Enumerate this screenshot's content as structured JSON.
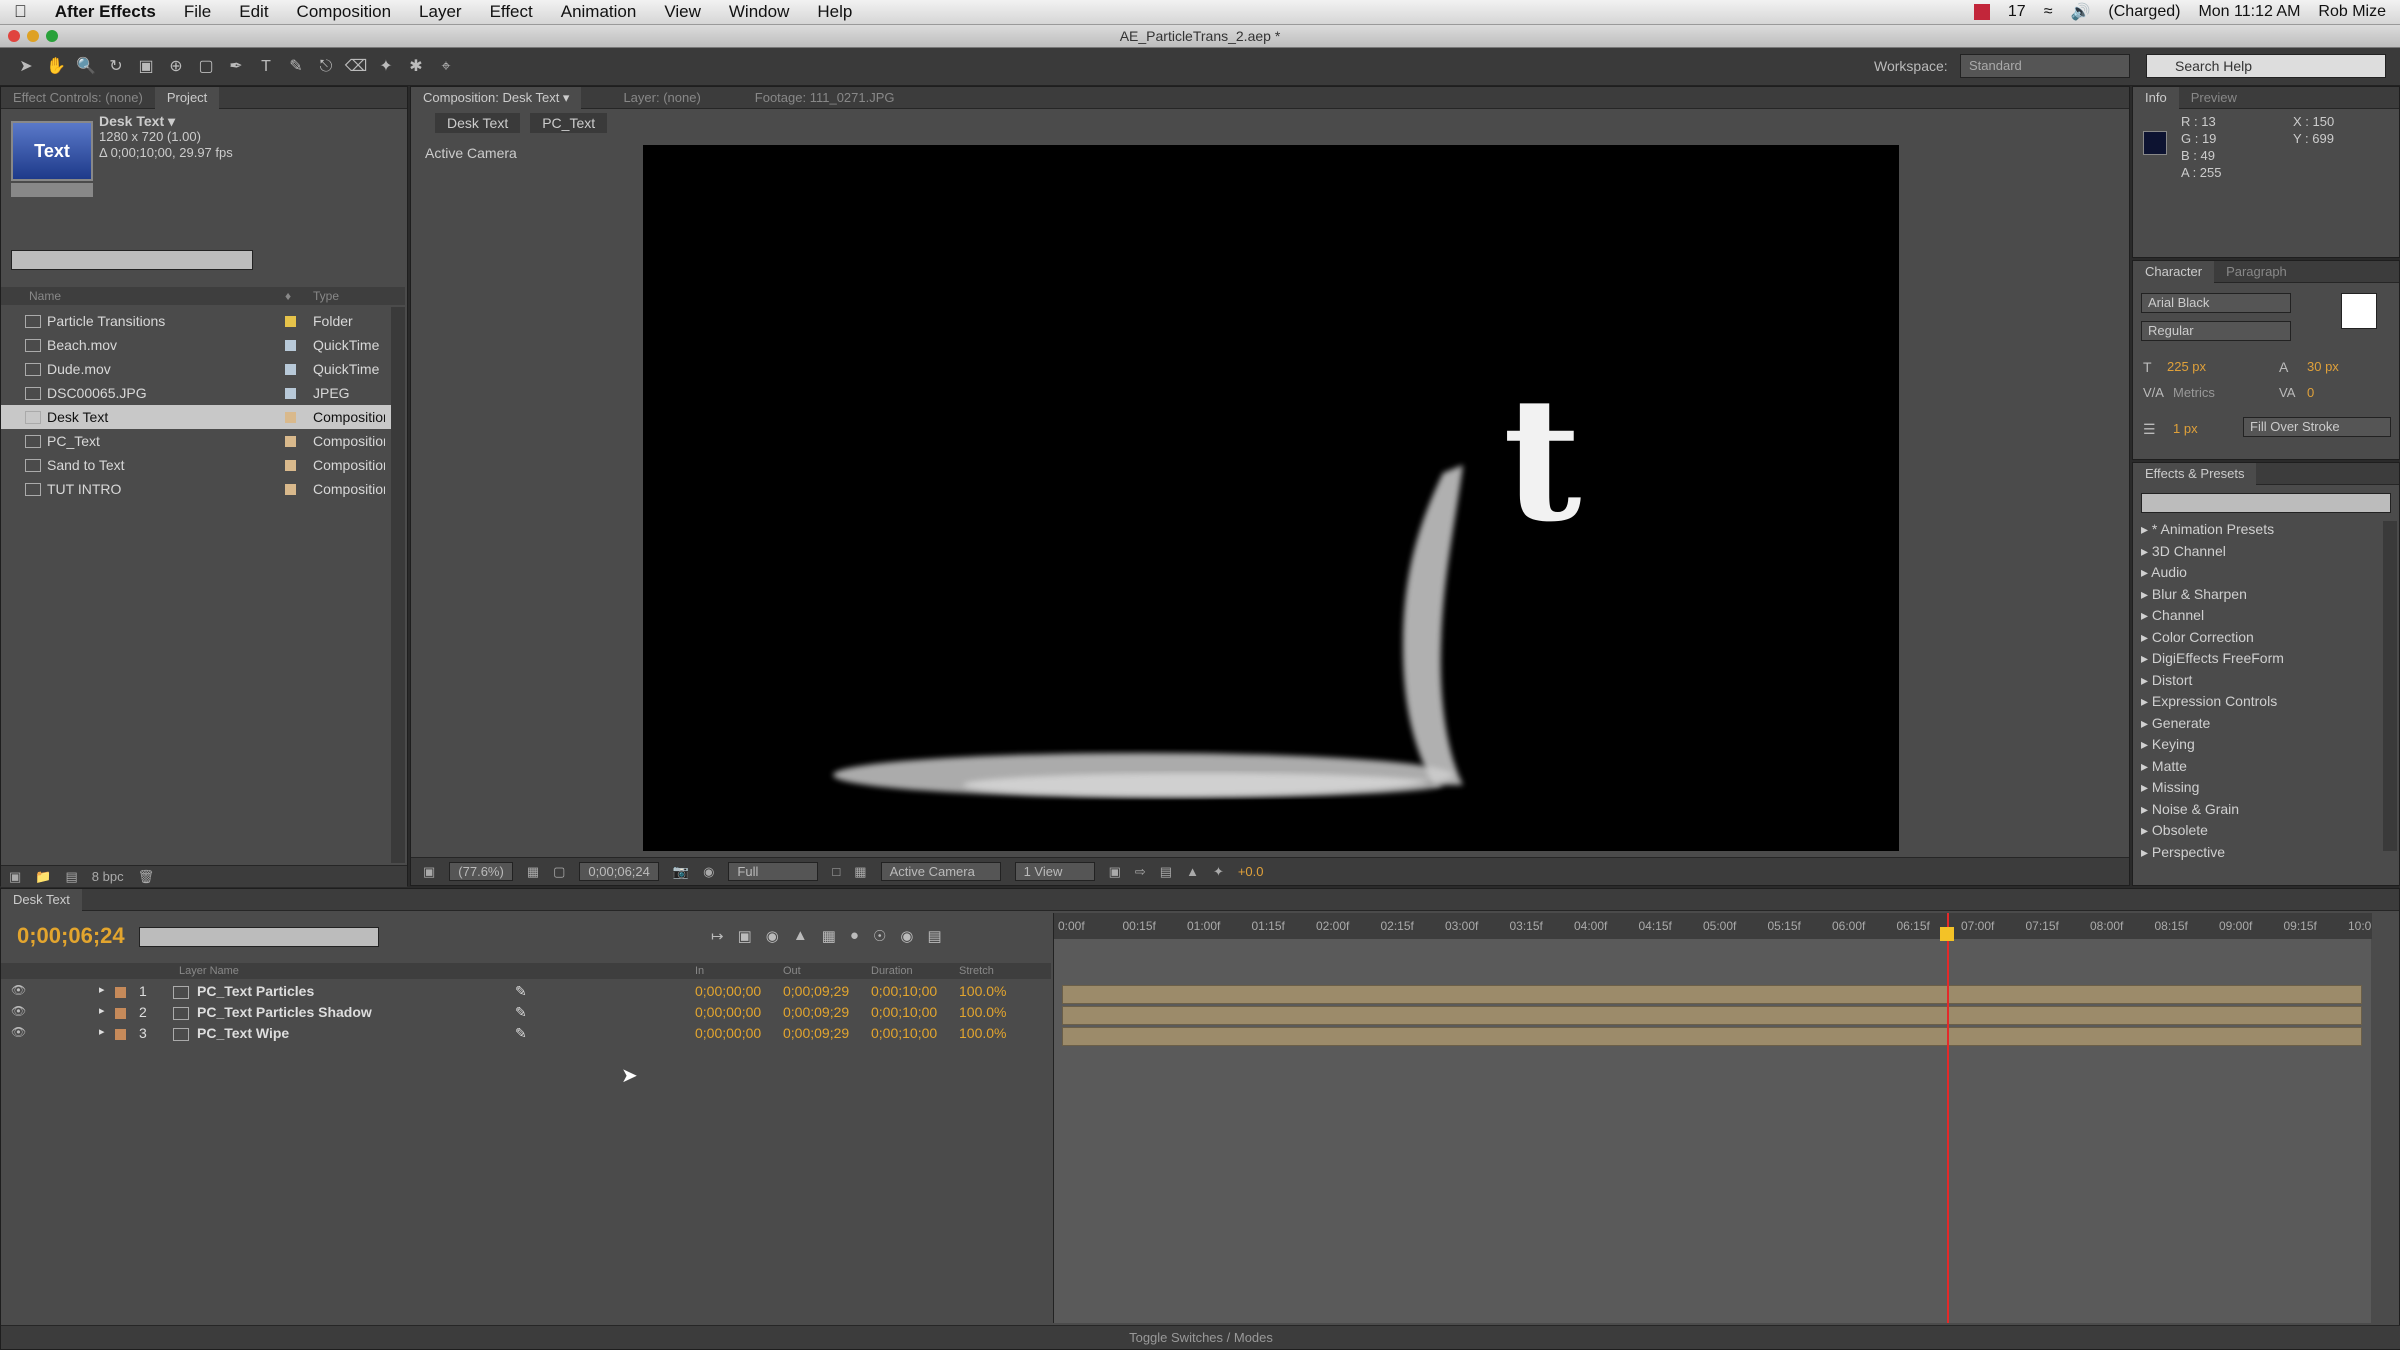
{
  "menubar": {
    "apple": "",
    "app_name": "After Effects",
    "items": [
      "File",
      "Edit",
      "Composition",
      "Layer",
      "Effect",
      "Animation",
      "View",
      "Window",
      "Help"
    ],
    "status": {
      "notif": "17",
      "battery": "(Charged)",
      "clock": "Mon 11:12 AM",
      "user": "Rob Mize"
    }
  },
  "window": {
    "title": "AE_ParticleTrans_2.aep *"
  },
  "toolbar": {
    "workspace_label": "Workspace:",
    "workspace_value": "Standard",
    "search_help": "Search Help"
  },
  "project": {
    "tabs": [
      "Effect Controls: (none)",
      "Project"
    ],
    "selected_item": {
      "name": "Desk Text ▾",
      "size": "1280 x 720 (1.00)",
      "duration": "Δ 0;00;10;00, 29.97 fps",
      "thumb_text": "Text"
    },
    "columns": {
      "name": "Name",
      "type": "Type"
    },
    "items": [
      {
        "name": "Particle Transitions",
        "type": "Folder",
        "color": "#e6c34a"
      },
      {
        "name": "Beach.mov",
        "type": "QuickTime",
        "color": "#b8c9d8"
      },
      {
        "name": "Dude.mov",
        "type": "QuickTime",
        "color": "#b8c9d8"
      },
      {
        "name": "DSC00065.JPG",
        "type": "JPEG",
        "color": "#b8c9d8"
      },
      {
        "name": "Desk Text",
        "type": "Composition",
        "color": "#d9b98c"
      },
      {
        "name": "PC_Text",
        "type": "Composition",
        "color": "#d9b98c"
      },
      {
        "name": "Sand to Text",
        "type": "Composition",
        "color": "#d9b98c"
      },
      {
        "name": "TUT INTRO",
        "type": "Composition",
        "color": "#d9b98c"
      }
    ],
    "footer_bpc": "8 bpc"
  },
  "comp": {
    "tabs": [
      "Composition: Desk Text ▾",
      "Layer: (none)",
      "Footage: 111_0271.JPG"
    ],
    "subtabs": [
      "Desk Text",
      "PC_Text"
    ],
    "camera_label": "Active Camera",
    "letter": "t",
    "footer": {
      "zoom": "(77.6%)",
      "time": "0;00;06;24",
      "resolution": "Full",
      "camera": "Active Camera",
      "views": "1 View",
      "exposure": "+0.0"
    }
  },
  "info": {
    "tabs": [
      "Info",
      "Preview"
    ],
    "r": "R : 13",
    "g": "G : 19",
    "b": "B : 49",
    "a": "A : 255",
    "x": "X : 150",
    "y": "Y : 699"
  },
  "character": {
    "tabs": [
      "Character",
      "Paragraph"
    ],
    "font": "Arial Black",
    "style": "Regular",
    "size": "225 px",
    "leading": "30 px",
    "kerning": "Metrics",
    "tracking": "0",
    "stroke_width": "1 px",
    "stroke_mode": "Fill Over Stroke"
  },
  "effects": {
    "title": "Effects & Presets",
    "items": [
      "* Animation Presets",
      "3D Channel",
      "Audio",
      "Blur & Sharpen",
      "Channel",
      "Color Correction",
      "DigiEffects FreeForm",
      "Distort",
      "Expression Controls",
      "Generate",
      "Keying",
      "Matte",
      "Missing",
      "Noise & Grain",
      "Obsolete",
      "Perspective"
    ]
  },
  "timeline": {
    "tab": "Desk Text",
    "timecode": "0;00;06;24",
    "columns": {
      "layer_name": "Layer Name",
      "in": "In",
      "out": "Out",
      "duration": "Duration",
      "stretch": "Stretch"
    },
    "ticks": [
      "0:00f",
      "00:15f",
      "01:00f",
      "01:15f",
      "02:00f",
      "02:15f",
      "03:00f",
      "03:15f",
      "04:00f",
      "04:15f",
      "05:00f",
      "05:15f",
      "06:00f",
      "06:15f",
      "07:00f",
      "07:15f",
      "08:00f",
      "08:15f",
      "09:00f",
      "09:15f",
      "10:0"
    ],
    "layers": [
      {
        "num": "1",
        "name": "PC_Text Particles",
        "in": "0;00;00;00",
        "out": "0;00;09;29",
        "duration": "0;00;10;00",
        "stretch": "100.0%"
      },
      {
        "num": "2",
        "name": "PC_Text Particles Shadow",
        "in": "0;00;00;00",
        "out": "0;00;09;29",
        "duration": "0;00;10;00",
        "stretch": "100.0%"
      },
      {
        "num": "3",
        "name": "PC_Text Wipe",
        "in": "0;00;00;00",
        "out": "0;00;09;29",
        "duration": "0;00;10;00",
        "stretch": "100.0%"
      }
    ],
    "footer": "Toggle Switches / Modes"
  }
}
